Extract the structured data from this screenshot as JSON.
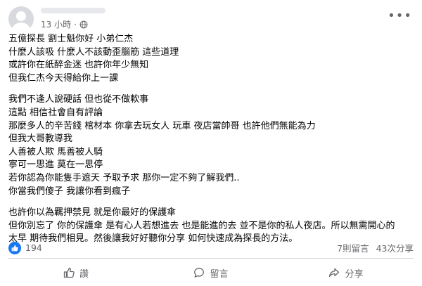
{
  "header": {
    "time": "13 小時",
    "visibility_icon": "globe-icon",
    "more_icon": "more-options-icon"
  },
  "body": {
    "paragraphs": [
      [
        "五億探長 劉士魁你好 小弟仁杰",
        "什麼人該吸 什麼人不該動歪腦筋 這些道理",
        "或許你在紙醉金迷 也許你年少無知",
        "但我仁杰今天得給你上一課"
      ],
      [
        "我們不逢人說硬話 但也從不做軟事",
        "這點 相信社會自有評論",
        "那麼多人的辛苦錢 棺材本 你拿去玩女人 玩車 夜店當帥哥 也許他們無能為力",
        "但我大哥教導我",
        "人善被人欺 馬善被人騎",
        "寧可一思進 莫在一思停",
        "若你認為你能隻手遮天 予取予求 那你一定不夠了解我們..",
        "你當我們傻子 我讓你看到瘋子"
      ],
      [
        "也許你以為羈押禁見 就是你最好的保護傘",
        "但你別忘了 你的保護傘 是有心人若想進去 也是能進的去  並不是你的私人夜店。所以無需開心的",
        "太早  期待我們相見。然後讓我好好聽你分享  如何快速成為探長的方法。"
      ]
    ]
  },
  "stats": {
    "reaction_icon": "thumbs-up-icon",
    "reaction_count": "194",
    "comments": "7則留言",
    "shares": "43次分享"
  },
  "actions": {
    "like_label": "讚",
    "comment_label": "留言",
    "share_label": "分享"
  },
  "colors": {
    "accent": "#1877f2",
    "secondary_text": "#65676b",
    "divider": "#ced0d4"
  }
}
